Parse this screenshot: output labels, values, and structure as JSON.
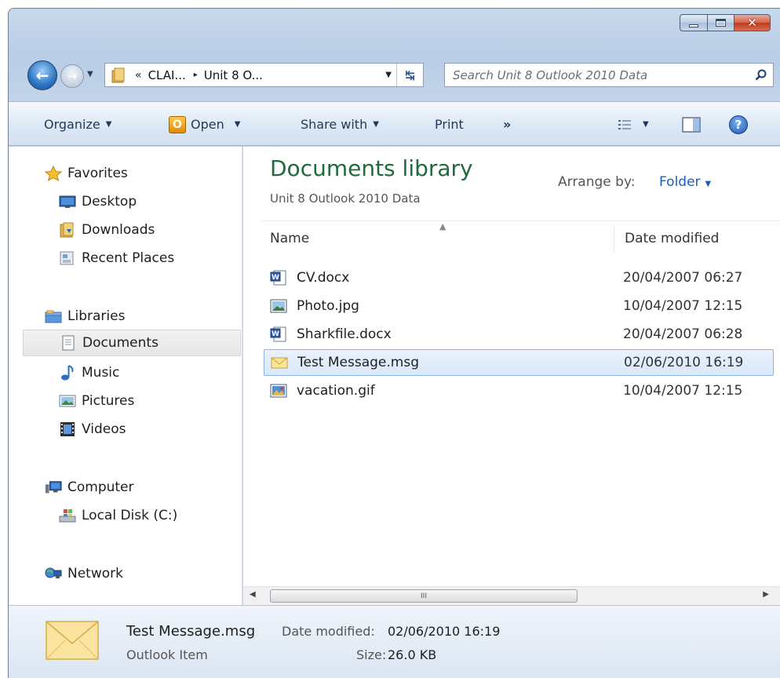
{
  "window": {
    "caption_minimize": "minimize",
    "caption_maximize": "maximize",
    "caption_close": "x"
  },
  "address_bar": {
    "chevron": "«",
    "crumbs": [
      "CLAI...",
      "Unit 8 O..."
    ],
    "separator": "▸"
  },
  "search": {
    "placeholder": "Search Unit 8 Outlook 2010 Data"
  },
  "toolbar": {
    "organize": "Organize",
    "open": "Open",
    "share_with": "Share with",
    "print": "Print",
    "more": "»"
  },
  "nav": {
    "favorites": "Favorites",
    "desktop": "Desktop",
    "downloads": "Downloads",
    "recent_places": "Recent Places",
    "libraries": "Libraries",
    "documents": "Documents",
    "music": "Music",
    "pictures": "Pictures",
    "videos": "Videos",
    "computer": "Computer",
    "local_disk": "Local Disk (C:)",
    "network": "Network"
  },
  "content": {
    "title": "Documents library",
    "subtitle": "Unit 8 Outlook 2010 Data",
    "arrange_label": "Arrange by:",
    "arrange_value": "Folder",
    "col_name": "Name",
    "col_date": "Date modified",
    "files": [
      {
        "name": "CV.docx",
        "date": "20/04/2007 06:27",
        "icon": "word-doc-icon"
      },
      {
        "name": "Photo.jpg",
        "date": "10/04/2007 12:15",
        "icon": "image-file-icon"
      },
      {
        "name": "Sharkfile.docx",
        "date": "20/04/2007 06:28",
        "icon": "word-doc-icon"
      },
      {
        "name": "Test Message.msg",
        "date": "02/06/2010 16:19",
        "icon": "envelope-icon"
      },
      {
        "name": "vacation.gif",
        "date": "10/04/2007 12:15",
        "icon": "gif-image-icon"
      }
    ],
    "scroll_grip": "III"
  },
  "details": {
    "name": "Test Message.msg",
    "type": "Outlook Item",
    "date_label": "Date modified:",
    "date_value": "02/06/2010 16:19",
    "size_label": "Size:",
    "size_value": "26.0 KB"
  },
  "colors": {
    "title_green": "#1e6b3b",
    "link_blue": "#1b5fb2",
    "selection_border": "#8fb4e2"
  }
}
